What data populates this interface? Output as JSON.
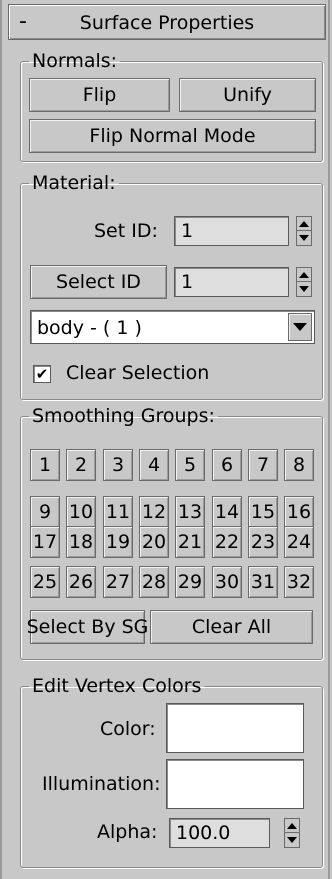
{
  "rollout": {
    "collapse_symbol": "-",
    "title": "Surface Properties"
  },
  "normals": {
    "legend": "Normals:",
    "flip_label": "Flip",
    "unify_label": "Unify",
    "flip_normal_mode_label": "Flip Normal Mode"
  },
  "material": {
    "legend": "Material:",
    "set_id_label": "Set ID:",
    "set_id_value": "1",
    "select_id_label": "Select ID",
    "select_id_value": "1",
    "material_selected": "body - ( 1 )",
    "clear_selection_label": "Clear Selection",
    "clear_selection_checked": true,
    "checkmark_glyph": "✔"
  },
  "smoothing": {
    "legend": "Smoothing Groups:",
    "groups": [
      "1",
      "2",
      "3",
      "4",
      "5",
      "6",
      "7",
      "8",
      "9",
      "10",
      "11",
      "12",
      "13",
      "14",
      "15",
      "16",
      "17",
      "18",
      "19",
      "20",
      "21",
      "22",
      "23",
      "24",
      "25",
      "26",
      "27",
      "28",
      "29",
      "30",
      "31",
      "32"
    ],
    "select_by_sg_label": "Select By SG",
    "clear_all_label": "Clear All"
  },
  "vertex_colors": {
    "legend": "Edit Vertex Colors",
    "color_label": "Color:",
    "color_value": "#ffffff",
    "illumination_label": "Illumination:",
    "illumination_value": "#ffffff",
    "alpha_label": "Alpha:",
    "alpha_value": "100.0"
  }
}
